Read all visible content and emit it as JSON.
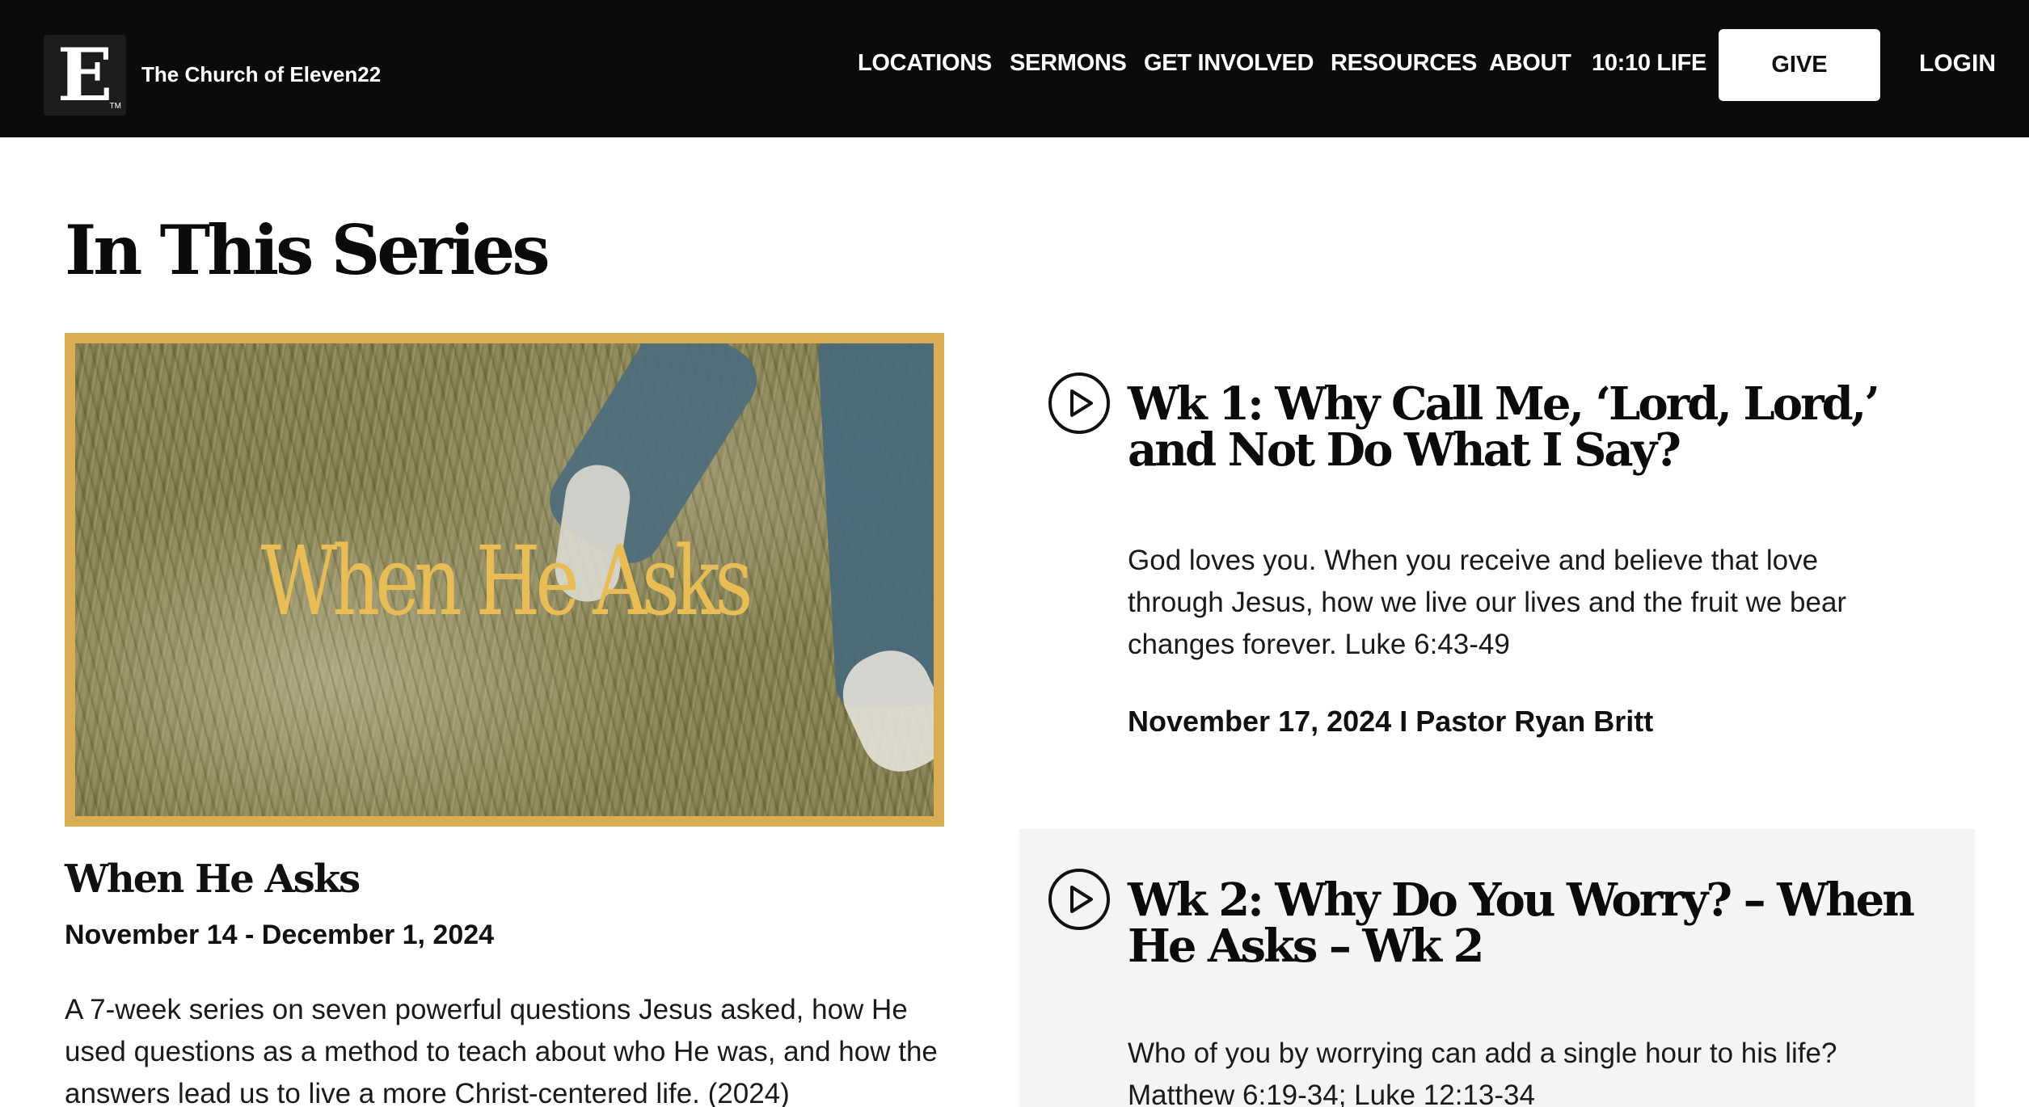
{
  "header": {
    "logo_letter": "E",
    "logo_tm": "TM",
    "church_name": "The Church of Eleven22",
    "nav": [
      "LOCATIONS",
      "SERMONS",
      "GET INVOLVED",
      "RESOURCES",
      "ABOUT",
      "10:10 LIFE"
    ],
    "give_label": "GIVE",
    "login_label": "LOGIN"
  },
  "page": {
    "title": "In This Series"
  },
  "series": {
    "image_text": "When He Asks",
    "name": "When He Asks",
    "dates": "November 14 - December 1, 2024",
    "description": "A 7-week series on seven powerful questions Jesus asked, how He used questions as a method to teach about who He was, and how the answers lead us to live a more Christ-centered life. (2024)"
  },
  "sermons": [
    {
      "title": "Wk 1: Why Call Me, ‘Lord, Lord,’ and Not Do What I Say?",
      "description": "God loves you. When you receive and believe that love through Jesus, how we live our lives and the fruit we bear changes forever. Luke 6:43-49",
      "meta": "November 17, 2024 I Pastor Ryan Britt"
    },
    {
      "title": "Wk 2: Why Do You Worry? – When He Asks – Wk 2",
      "description": "Who of you by worrying can add a single hour to his life? Matthew 6:19-34; Luke 12:13-34",
      "meta": ""
    }
  ],
  "colors": {
    "header_bg": "#0b0b0b",
    "accent_gold": "#d9ad52",
    "card_alt_bg": "#f4f4f4"
  }
}
